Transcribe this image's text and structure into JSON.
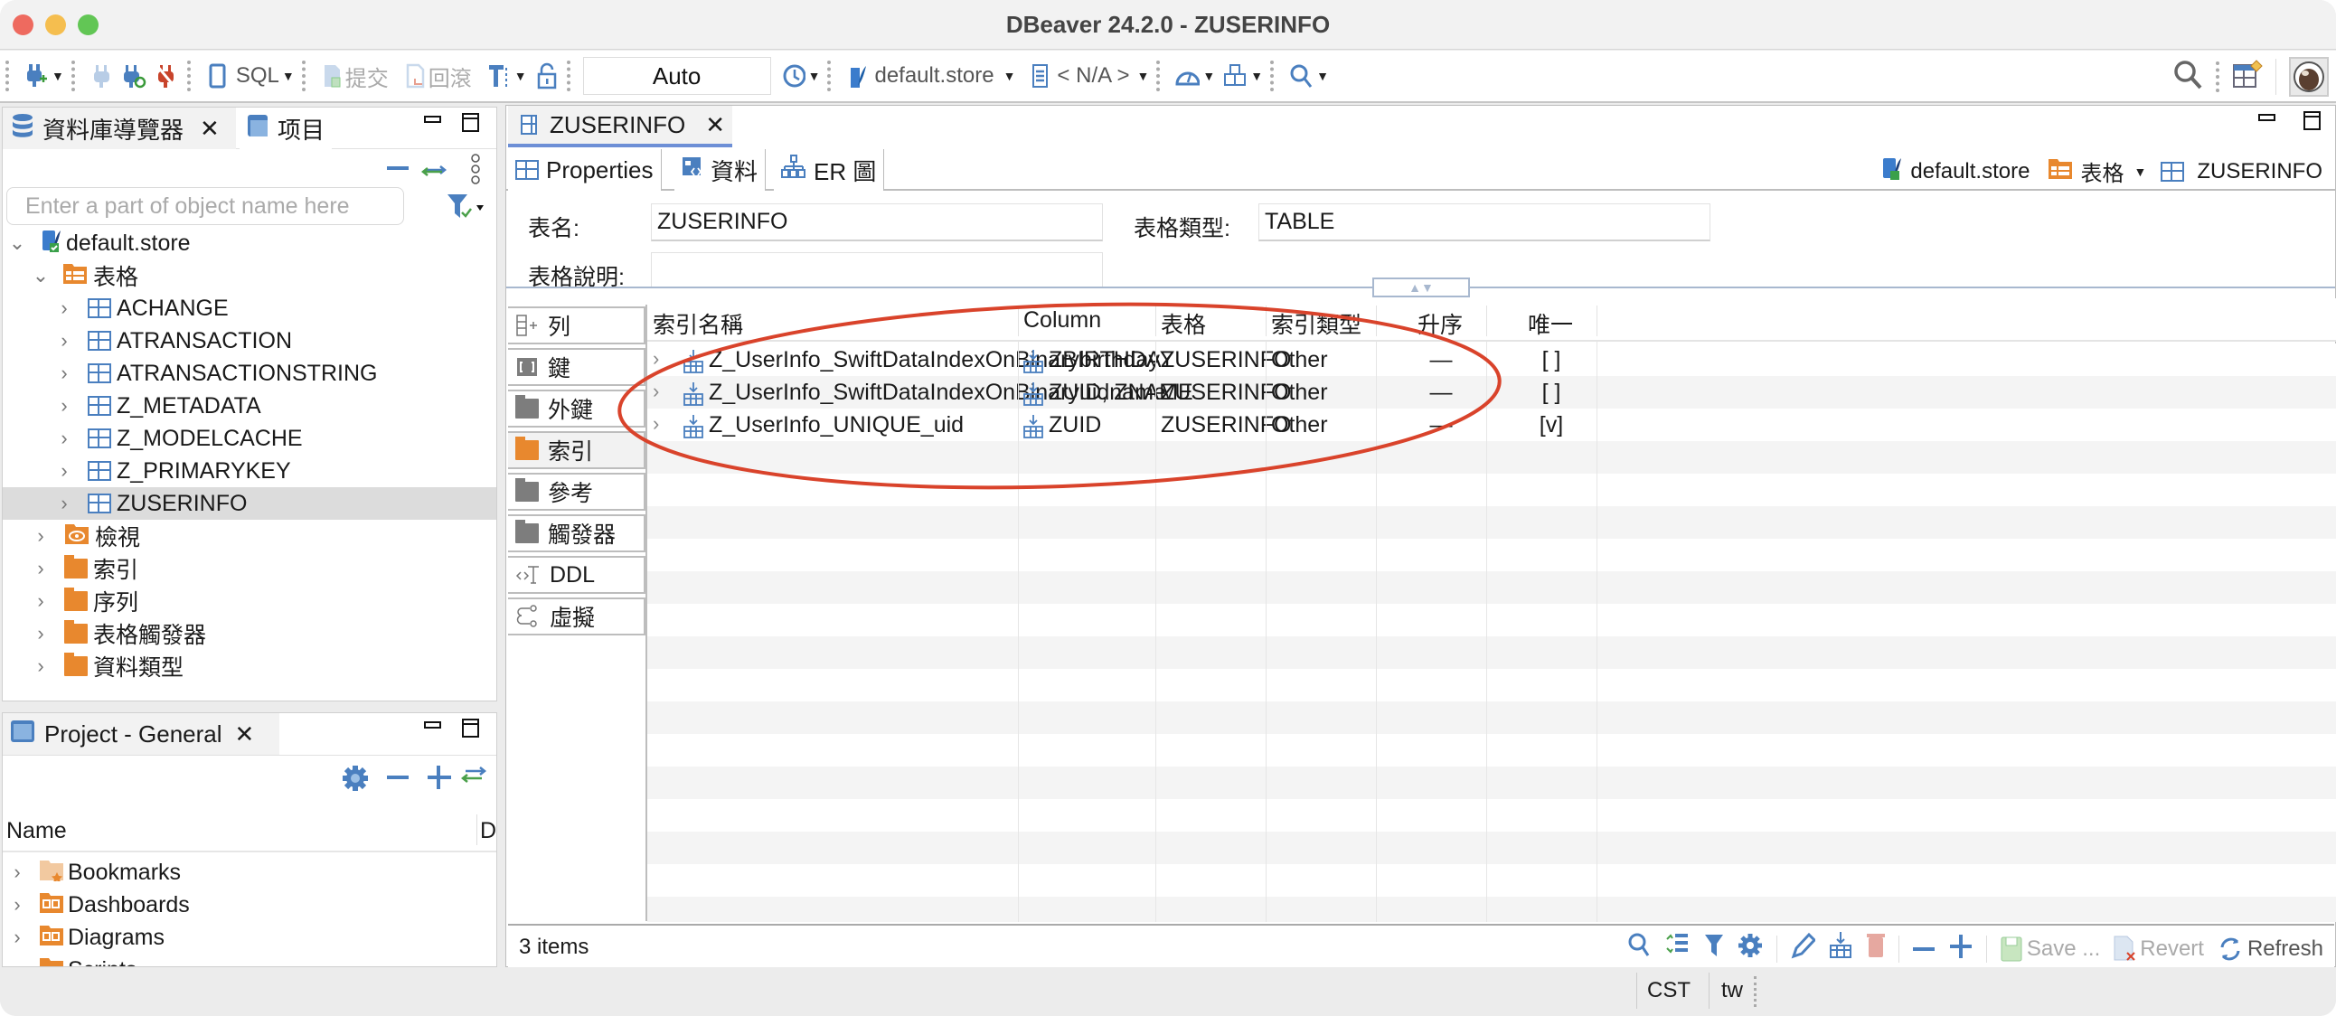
{
  "window": {
    "title": "DBeaver 24.2.0 - ZUSERINFO"
  },
  "toolbar": {
    "sql_label": "SQL",
    "commit_label": "提交",
    "rollback_label": "回滾",
    "transaction_mode": "Auto",
    "datasource": "default.store",
    "schema": "< N/A >"
  },
  "navigator": {
    "tab_label": "資料庫導覽器",
    "projects_tab_label": "项目",
    "search_placeholder": "Enter a part of object name here",
    "root": "default.store",
    "tables_folder": "表格",
    "tables": [
      "ACHANGE",
      "ATRANSACTION",
      "ATRANSACTIONSTRING",
      "Z_METADATA",
      "Z_MODELCACHE",
      "Z_PRIMARYKEY",
      "ZUSERINFO"
    ],
    "selected_table": "ZUSERINFO",
    "folders": [
      "檢視",
      "索引",
      "序列",
      "表格觸發器",
      "資料類型"
    ]
  },
  "project": {
    "tab_label": "Project - General",
    "col_name": "Name",
    "col_d": "D",
    "items": [
      "Bookmarks",
      "Dashboards",
      "Diagrams",
      "Scripts"
    ]
  },
  "editor": {
    "tab_label": "ZUSERINFO",
    "subtabs": [
      "Properties",
      "資料",
      "ER 圖"
    ],
    "breadcrumb": {
      "datasource": "default.store",
      "folder": "表格",
      "table": "ZUSERINFO"
    },
    "form": {
      "name_label": "表名:",
      "name_value": "ZUSERINFO",
      "type_label": "表格類型:",
      "type_value": "TABLE",
      "desc_label": "表格說明:"
    },
    "side_tabs": [
      "列",
      "鍵",
      "外鍵",
      "索引",
      "參考",
      "觸發器",
      "DDL",
      "虛擬"
    ],
    "active_side_tab": "索引",
    "grid": {
      "columns": [
        "索引名稱",
        "Column",
        "表格",
        "索引類型",
        "升序",
        "唯一"
      ],
      "rows": [
        {
          "name": "Z_UserInfo_SwiftDataIndexOnBinarybirthday",
          "column": "ZBIRTHDAY",
          "table": "ZUSERINFO",
          "type": "Other",
          "asc": "—",
          "unique": "[ ]"
        },
        {
          "name": "Z_UserInfo_SwiftDataIndexOnBinaryuidname",
          "column": "ZUID, ZNAME",
          "table": "ZUSERINFO",
          "type": "Other",
          "asc": "—",
          "unique": "[ ]"
        },
        {
          "name": "Z_UserInfo_UNIQUE_uid",
          "column": "ZUID",
          "table": "ZUSERINFO",
          "type": "Other",
          "asc": "—",
          "unique": "[v]"
        }
      ]
    },
    "item_count": "3 items",
    "actions": {
      "save": "Save ...",
      "revert": "Revert",
      "refresh": "Refresh"
    }
  },
  "statusbar": {
    "timezone": "CST",
    "locale": "tw"
  },
  "colors": {
    "accent": "#4a7fbf",
    "folder": "#e8882e",
    "annotation": "#d9432b"
  }
}
